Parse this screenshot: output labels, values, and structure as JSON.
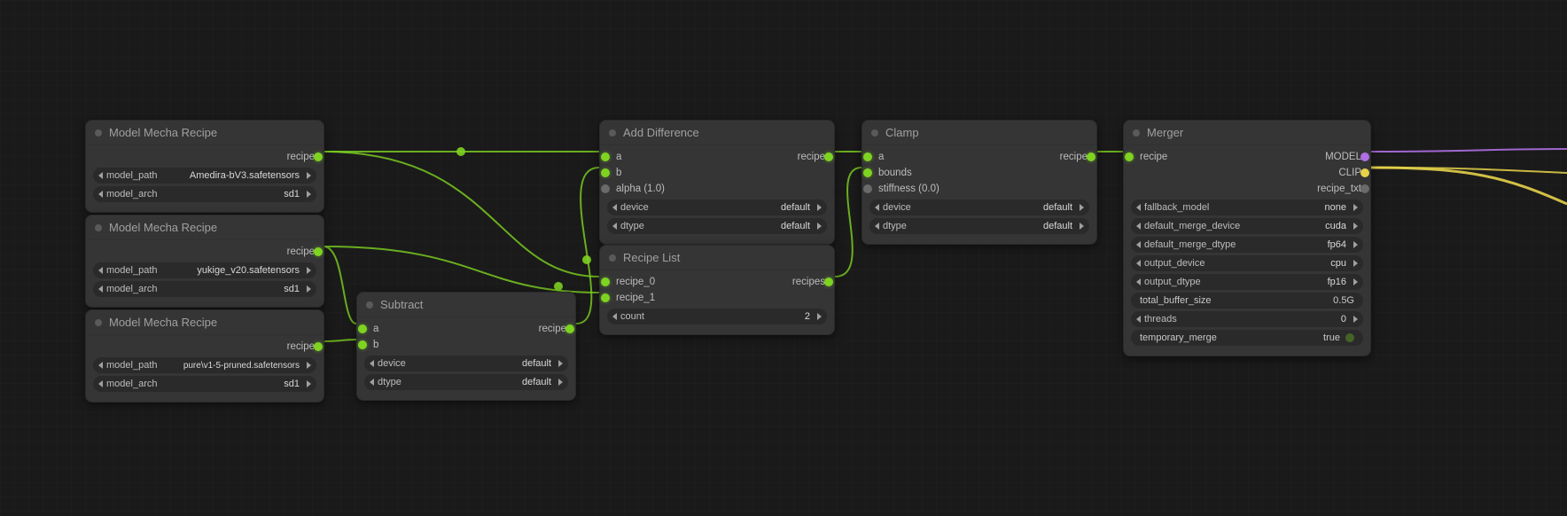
{
  "nodes": {
    "mecha1": {
      "title": "Model Mecha Recipe",
      "out_recipe": "recipe",
      "model_path_label": "model_path",
      "model_path_value": "Amedira-bV3.safetensors",
      "model_arch_label": "model_arch",
      "model_arch_value": "sd1"
    },
    "mecha2": {
      "title": "Model Mecha Recipe",
      "out_recipe": "recipe",
      "model_path_label": "model_path",
      "model_path_value": "yukige_v20.safetensors",
      "model_arch_label": "model_arch",
      "model_arch_value": "sd1"
    },
    "mecha3": {
      "title": "Model Mecha Recipe",
      "out_recipe": "recipe",
      "model_path_label": "model_path",
      "model_path_value": "pure\\v1-5-pruned.safetensors",
      "model_arch_label": "model_arch",
      "model_arch_value": "sd1"
    },
    "subtract": {
      "title": "Subtract",
      "in_a": "a",
      "in_b": "b",
      "out_recipe": "recipe",
      "device_label": "device",
      "device_value": "default",
      "dtype_label": "dtype",
      "dtype_value": "default"
    },
    "adddiff": {
      "title": "Add Difference",
      "in_a": "a",
      "in_b": "b",
      "alpha_label": "alpha (1.0)",
      "out_recipe": "recipe",
      "device_label": "device",
      "device_value": "default",
      "dtype_label": "dtype",
      "dtype_value": "default"
    },
    "recipelist": {
      "title": "Recipe List",
      "in_r0": "recipe_0",
      "in_r1": "recipe_1",
      "out_recipes": "recipes",
      "count_label": "count",
      "count_value": "2"
    },
    "clamp": {
      "title": "Clamp",
      "in_a": "a",
      "in_bounds": "bounds",
      "stiffness_label": "stiffness (0.0)",
      "out_recipe": "recipe",
      "device_label": "device",
      "device_value": "default",
      "dtype_label": "dtype",
      "dtype_value": "default"
    },
    "merger": {
      "title": "Merger",
      "in_recipe": "recipe",
      "out_model": "MODEL",
      "out_clip": "CLIP",
      "out_recipe_txt": "recipe_txt",
      "fallback_model_label": "fallback_model",
      "fallback_model_value": "none",
      "default_merge_device_label": "default_merge_device",
      "default_merge_device_value": "cuda",
      "default_merge_dtype_label": "default_merge_dtype",
      "default_merge_dtype_value": "fp64",
      "output_device_label": "output_device",
      "output_device_value": "cpu",
      "output_dtype_label": "output_dtype",
      "output_dtype_value": "fp16",
      "total_buffer_size_label": "total_buffer_size",
      "total_buffer_size_value": "0.5G",
      "threads_label": "threads",
      "threads_value": "0",
      "temporary_merge_label": "temporary_merge",
      "temporary_merge_value": "true"
    }
  }
}
